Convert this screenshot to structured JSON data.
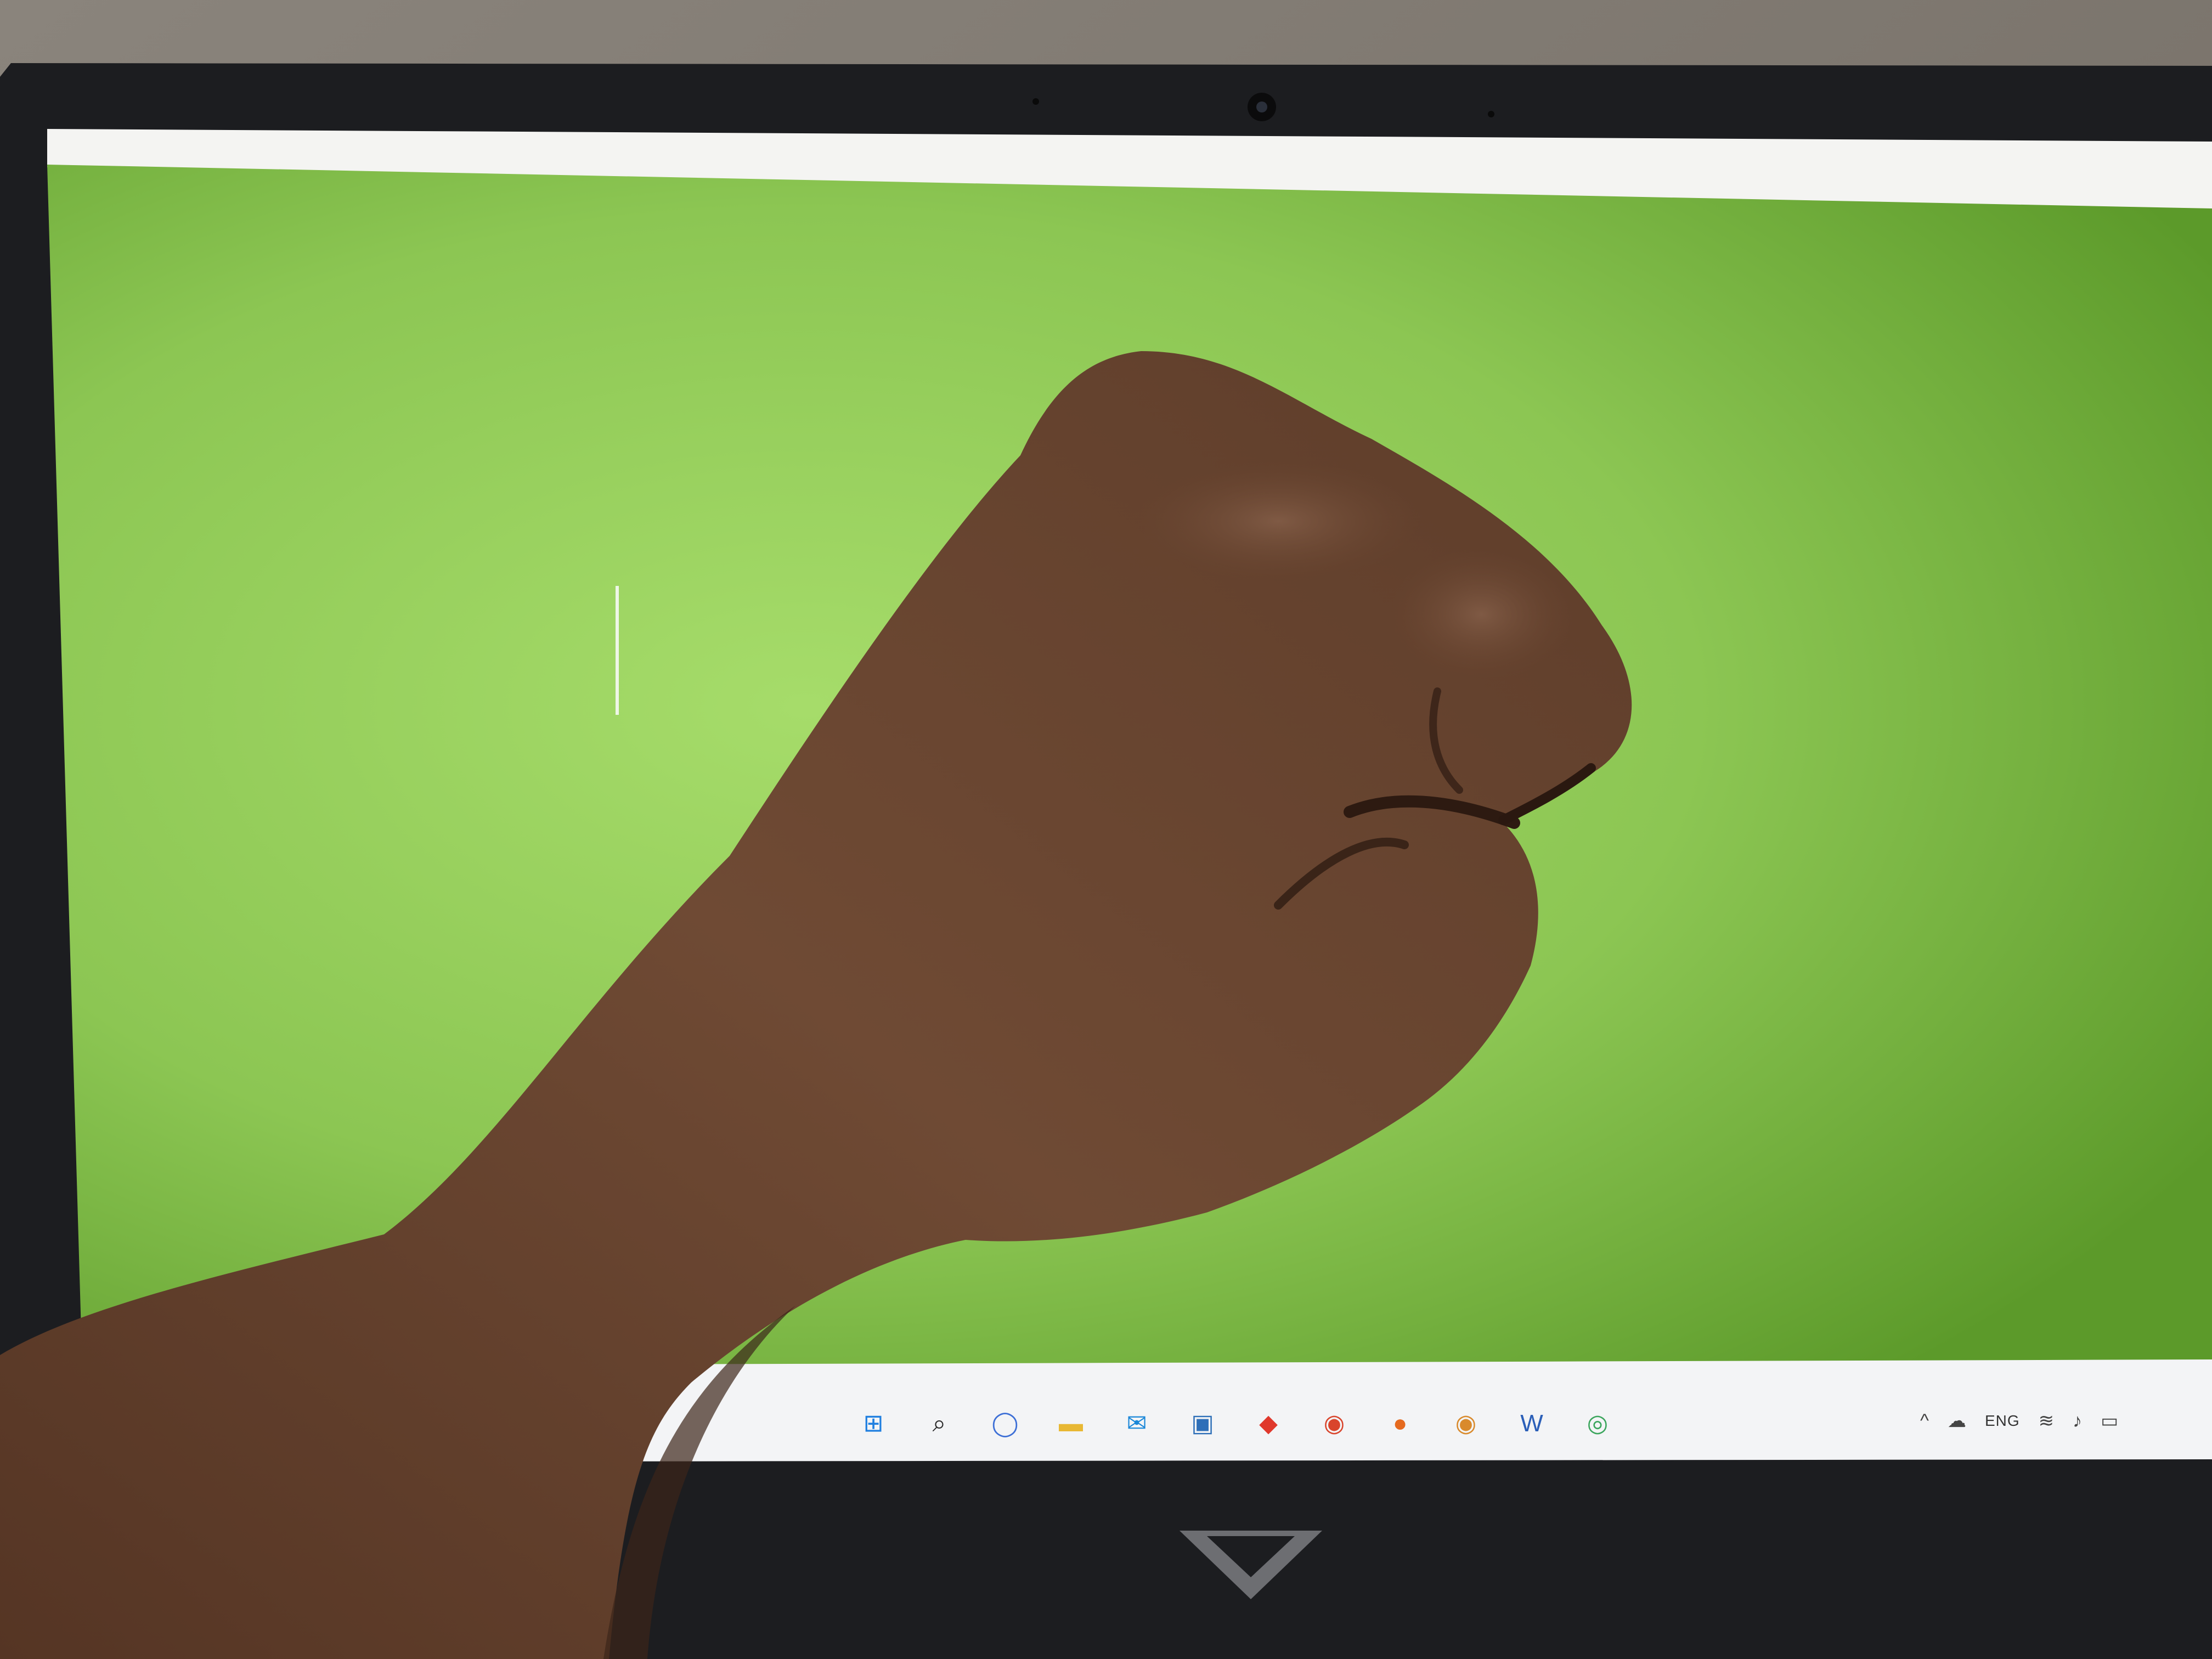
{
  "image": {
    "kind": "photo of a laptop screen with a raised fist in front",
    "colors": {
      "desktop_green": "#92c95a",
      "desktop_green_dark": "#5f9a2b",
      "bezel": "#1c1d20",
      "skin": "#6b4631",
      "skin_shadow": "#3c2519",
      "background_fabric": "#7a736b"
    }
  },
  "desktop": {
    "wallpaper": "solid green"
  },
  "taskbar": {
    "pinned_icons": [
      {
        "name": "start-icon",
        "glyph": "⊞",
        "color": "#1f7fe0"
      },
      {
        "name": "search-icon",
        "glyph": "⌕",
        "color": "#2a2a2a"
      },
      {
        "name": "chat-icon",
        "glyph": "◯",
        "color": "#3d6fd6"
      },
      {
        "name": "file-explorer-icon",
        "glyph": "▬",
        "color": "#e8b834"
      },
      {
        "name": "mail-icon",
        "glyph": "✉",
        "color": "#1a87d8"
      },
      {
        "name": "store-icon",
        "glyph": "▣",
        "color": "#2e6fb8"
      },
      {
        "name": "app-red-icon",
        "glyph": "◆",
        "color": "#e0382c"
      },
      {
        "name": "chrome-icon",
        "glyph": "◉",
        "color": "#d9452c"
      },
      {
        "name": "firefox-icon",
        "glyph": "●",
        "color": "#e56a1f"
      },
      {
        "name": "chrome-profile-icon",
        "glyph": "◉",
        "color": "#d98a2c"
      },
      {
        "name": "word-icon",
        "glyph": "W",
        "color": "#2b5fb8"
      },
      {
        "name": "app-green-icon",
        "glyph": "◎",
        "color": "#3aa55c"
      }
    ],
    "tray": {
      "chevron_glyph": "^",
      "cloud_glyph": "☁",
      "language": "ENG",
      "wifi_glyph": "≋",
      "volume_glyph": "♪",
      "battery_glyph": "▭"
    }
  }
}
